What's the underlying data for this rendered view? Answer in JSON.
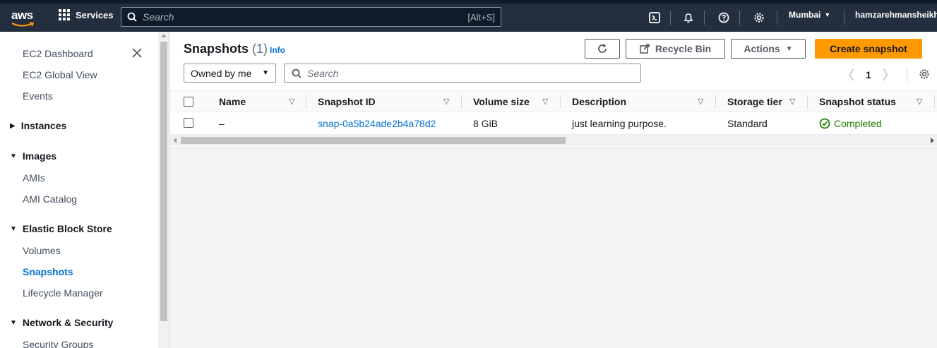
{
  "topnav": {
    "logo_text": "aws",
    "services_label": "Services",
    "search_placeholder": "Search",
    "search_shortcut": "[Alt+S]",
    "region": "Mumbai",
    "user": "hamzarehmansheikh"
  },
  "sidebar": {
    "items": [
      {
        "label": "EC2 Dashboard"
      },
      {
        "label": "EC2 Global View"
      },
      {
        "label": "Events"
      }
    ],
    "sections": [
      {
        "label": "Instances",
        "expanded": false
      },
      {
        "label": "Images",
        "expanded": true,
        "items": [
          "AMIs",
          "AMI Catalog"
        ]
      },
      {
        "label": "Elastic Block Store",
        "expanded": true,
        "items": [
          "Volumes",
          "Snapshots",
          "Lifecycle Manager"
        ]
      },
      {
        "label": "Network & Security",
        "expanded": true,
        "items": [
          "Security Groups"
        ]
      }
    ],
    "active_item": "Snapshots"
  },
  "main": {
    "title": "Snapshots",
    "count": "(1)",
    "info_link": "Info",
    "buttons": {
      "recycle_bin": "Recycle Bin",
      "actions": "Actions",
      "create": "Create snapshot"
    },
    "owner_filter": "Owned by me",
    "filter_placeholder": "Search",
    "page": "1",
    "columns": [
      "Name",
      "Snapshot ID",
      "Volume size",
      "Description",
      "Storage tier",
      "Snapshot status"
    ],
    "rows": [
      {
        "name": "–",
        "snapshot_id": "snap-0a5b24ade2b4a78d2",
        "volume_size": "8 GiB",
        "description": "just learning purpose.",
        "storage_tier": "Standard",
        "status": "Completed"
      }
    ]
  },
  "colors": {
    "nav_bg": "#232f3e",
    "accent": "#ff9900",
    "link": "#0972d3",
    "success": "#1d8102"
  }
}
